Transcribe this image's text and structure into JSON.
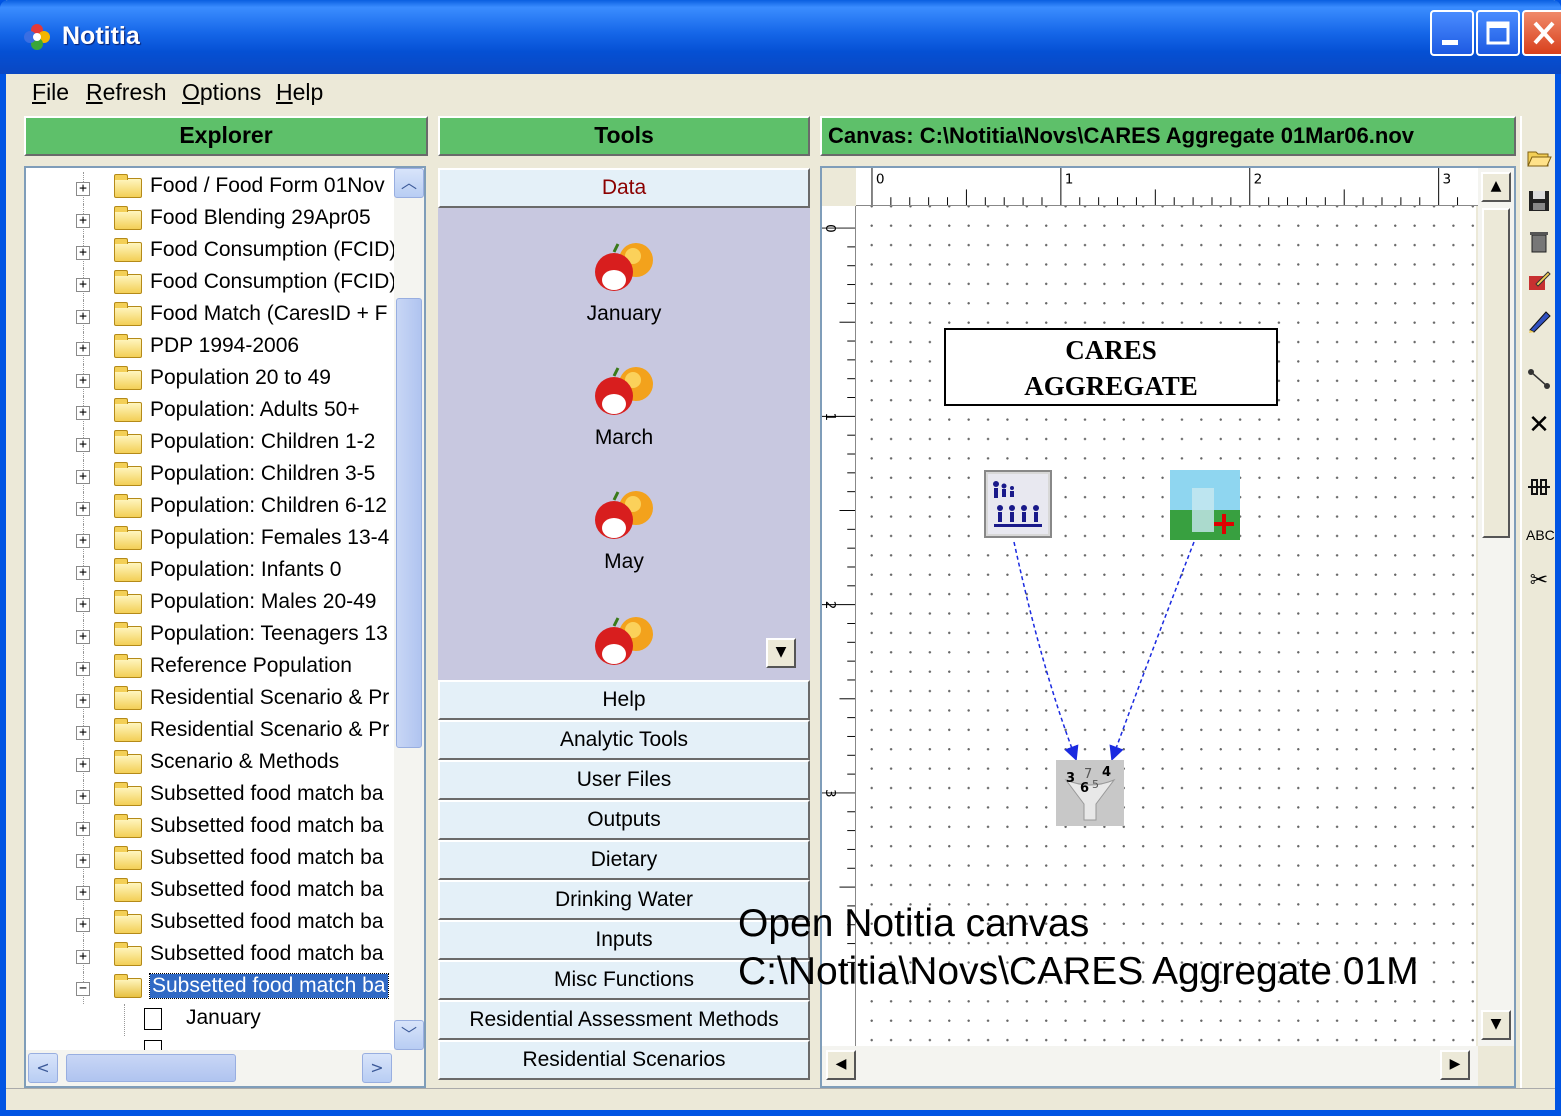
{
  "window": {
    "title": "Notitia",
    "buttons": {
      "minimize": "minimize-icon",
      "maximize": "maximize-icon",
      "close": "close-icon"
    }
  },
  "menu": [
    {
      "label": "File",
      "mnemonic": "F"
    },
    {
      "label": "Refresh",
      "mnemonic": "R"
    },
    {
      "label": "Options",
      "mnemonic": "O"
    },
    {
      "label": "Help",
      "mnemonic": "H"
    }
  ],
  "explorer": {
    "header": "Explorer",
    "items": [
      "Food / Food Form 01Nov",
      "Food Blending 29Apr05",
      "Food Consumption (FCID)",
      "Food Consumption (FCID)",
      "Food Match (CaresID + F",
      "PDP 1994-2006",
      "Population 20 to 49",
      "Population: Adults 50+",
      "Population: Children 1-2",
      "Population: Children 3-5",
      "Population: Children 6-12",
      "Population: Females 13-4",
      "Population: Infants 0",
      "Population: Males 20-49",
      "Population: Teenagers 13",
      "Reference Population",
      "Residential Scenario & Pr",
      "Residential Scenario & Pr",
      "Scenario & Methods",
      "Subsetted food match ba",
      "Subsetted food match ba",
      "Subsetted food match ba",
      "Subsetted food match ba",
      "Subsetted food match ba",
      "Subsetted food match ba"
    ],
    "selected_item": "Subsetted food match ba",
    "child_item": "January"
  },
  "tools": {
    "header": "Tools",
    "active_section": "Data",
    "data_items": [
      "January",
      "March",
      "May"
    ],
    "sections": [
      "Help",
      "Analytic Tools",
      "User Files",
      "Outputs",
      "Dietary",
      "Drinking Water",
      "Inputs",
      "Misc Functions",
      "Residential Assessment Methods",
      "Residential Scenarios"
    ]
  },
  "canvas": {
    "header": "Canvas: C:\\Notitia\\Novs\\CARES Aggregate 01Mar06.nov",
    "ruler_top": [
      "0",
      "1",
      "2",
      "3"
    ],
    "ruler_left": [
      "0",
      "1",
      "2",
      "3"
    ],
    "title_box": [
      "CARES",
      "AGGREGATE"
    ],
    "nodes": [
      "population-node-icon",
      "water-node-icon",
      "aggregate-node-icon"
    ],
    "aggregate_digits": [
      "3",
      "7",
      "4",
      "6",
      "5"
    ]
  },
  "right_toolbar": [
    "open-folder-icon",
    "save-icon",
    "trash-icon",
    "edit-icon",
    "pen-icon",
    "connect-icon",
    "delete-icon",
    "align-icon",
    "text-icon",
    "cut-icon"
  ],
  "right_toolbar_text": "ABC",
  "caption": {
    "line1": "Open Notitia canvas",
    "line2": "C:\\Notitia\\Novs\\CARES Aggregate 01M"
  },
  "colors": {
    "header_green": "#5ec06a",
    "tools_bg": "#c8c8e0",
    "xp_blue": "#0054e3"
  }
}
